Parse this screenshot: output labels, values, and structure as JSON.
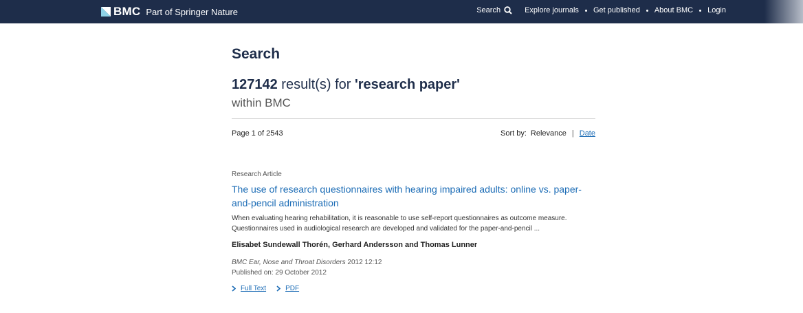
{
  "header": {
    "logo_text": "BMC",
    "tagline": "Part of Springer Nature",
    "nav": {
      "search_label": "Search",
      "explore_label": "Explore journals",
      "get_published_label": "Get published",
      "about_label": "About BMC",
      "login_label": "Login"
    },
    "icons": {
      "logo": "bmc-logo-icon",
      "search": "search-icon"
    },
    "colors": {
      "bar": "#1e2d4a",
      "link": "#1a6bb5"
    }
  },
  "main": {
    "title": "Search",
    "results": {
      "count": "127142",
      "middle": " result(s) for ",
      "query": "'research paper'",
      "scope": "within BMC"
    },
    "pagination": {
      "label": "Page 1 of 2543"
    },
    "sort": {
      "label": "Sort by:",
      "relevance": "Relevance",
      "separator": "|",
      "date": "Date"
    },
    "items": [
      {
        "type": "Research Article",
        "title": "The use of research questionnaires with hearing impaired adults: online vs. paper-and-pencil administration",
        "snippet": "When evaluating hearing rehabilitation, it is reasonable to use self-report questionnaires as outcome measure. Questionnaires used in audiological research are developed and validated for the paper-and-pencil ...",
        "authors": "Elisabet Sundewall Thorén, Gerhard Andersson and Thomas Lunner",
        "journal": "BMC Ear, Nose and Throat Disorders",
        "journal_ref": " 2012 12:12",
        "published": "Published on: 29 October 2012",
        "full_text_label": "Full Text",
        "pdf_label": "PDF"
      }
    ]
  }
}
